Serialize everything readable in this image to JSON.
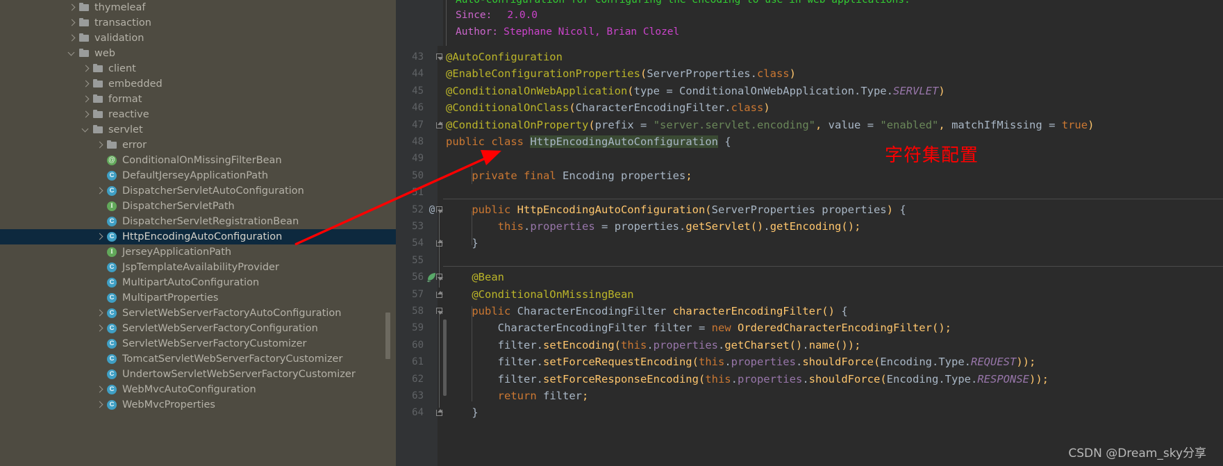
{
  "sidebar": {
    "items": [
      {
        "label": "thymeleaf",
        "icon": "folder-icon",
        "arrow": "right",
        "indent": 0
      },
      {
        "label": "transaction",
        "icon": "folder-icon",
        "arrow": "right",
        "indent": 0
      },
      {
        "label": "validation",
        "icon": "folder-icon",
        "arrow": "right",
        "indent": 0
      },
      {
        "label": "web",
        "icon": "folder-icon",
        "arrow": "down",
        "indent": 0
      },
      {
        "label": "client",
        "icon": "folder-icon",
        "arrow": "right",
        "indent": 1
      },
      {
        "label": "embedded",
        "icon": "folder-icon",
        "arrow": "right",
        "indent": 1
      },
      {
        "label": "format",
        "icon": "folder-icon",
        "arrow": "right",
        "indent": 1
      },
      {
        "label": "reactive",
        "icon": "folder-icon",
        "arrow": "right",
        "indent": 1
      },
      {
        "label": "servlet",
        "icon": "folder-icon",
        "arrow": "down",
        "indent": 1
      },
      {
        "label": "error",
        "icon": "folder-icon",
        "arrow": "right",
        "indent": 2
      },
      {
        "label": "ConditionalOnMissingFilterBean",
        "icon": "annotation-icon",
        "arrow": "none",
        "indent": 2
      },
      {
        "label": "DefaultJerseyApplicationPath",
        "icon": "class-icon",
        "arrow": "none",
        "indent": 2
      },
      {
        "label": "DispatcherServletAutoConfiguration",
        "icon": "class-icon",
        "arrow": "right",
        "indent": 2
      },
      {
        "label": "DispatcherServletPath",
        "icon": "interface-icon",
        "arrow": "none",
        "indent": 2
      },
      {
        "label": "DispatcherServletRegistrationBean",
        "icon": "class-icon",
        "arrow": "none",
        "indent": 2
      },
      {
        "label": "HttpEncodingAutoConfiguration",
        "icon": "class-icon",
        "arrow": "right",
        "indent": 2,
        "selected": true
      },
      {
        "label": "JerseyApplicationPath",
        "icon": "interface-icon",
        "arrow": "none",
        "indent": 2
      },
      {
        "label": "JspTemplateAvailabilityProvider",
        "icon": "class-icon",
        "arrow": "none",
        "indent": 2
      },
      {
        "label": "MultipartAutoConfiguration",
        "icon": "class-icon",
        "arrow": "none",
        "indent": 2
      },
      {
        "label": "MultipartProperties",
        "icon": "class-icon",
        "arrow": "none",
        "indent": 2
      },
      {
        "label": "ServletWebServerFactoryAutoConfiguration",
        "icon": "class-icon",
        "arrow": "right",
        "indent": 2
      },
      {
        "label": "ServletWebServerFactoryConfiguration",
        "icon": "class-icon",
        "arrow": "right",
        "indent": 2
      },
      {
        "label": "ServletWebServerFactoryCustomizer",
        "icon": "class-icon",
        "arrow": "none",
        "indent": 2
      },
      {
        "label": "TomcatServletWebServerFactoryCustomizer",
        "icon": "class-icon",
        "arrow": "none",
        "indent": 2
      },
      {
        "label": "UndertowServletWebServerFactoryCustomizer",
        "icon": "class-icon",
        "arrow": "none",
        "indent": 2
      },
      {
        "label": "WebMvcAutoConfiguration",
        "icon": "class-icon",
        "arrow": "right",
        "indent": 2
      },
      {
        "label": "WebMvcProperties",
        "icon": "class-icon",
        "arrow": "right",
        "indent": 2
      }
    ]
  },
  "doc_popup": {
    "description": "Auto-configuration for configuring the encoding to use in web applications.",
    "since_label": "Since:",
    "since_value": "2.0.0",
    "author_label": "Author:",
    "author_value": "Stephane Nicoll, Brian Clozel"
  },
  "editor": {
    "first_line_number": 43,
    "lines": [
      {
        "n": 43,
        "text": "@AutoConfiguration"
      },
      {
        "n": 44,
        "text": "@EnableConfigurationProperties(ServerProperties.class)"
      },
      {
        "n": 45,
        "text": "@ConditionalOnWebApplication(type = ConditionalOnWebApplication.Type.SERVLET)"
      },
      {
        "n": 46,
        "text": "@ConditionalOnClass(CharacterEncodingFilter.class)"
      },
      {
        "n": 47,
        "text": "@ConditionalOnProperty(prefix = \"server.servlet.encoding\", value = \"enabled\", matchIfMissing = true)"
      },
      {
        "n": 48,
        "text": "public class HttpEncodingAutoConfiguration {"
      },
      {
        "n": 49,
        "text": ""
      },
      {
        "n": 50,
        "text": "    private final Encoding properties;"
      },
      {
        "n": 51,
        "text": ""
      },
      {
        "n": 52,
        "text": "    public HttpEncodingAutoConfiguration(ServerProperties properties) {"
      },
      {
        "n": 53,
        "text": "        this.properties = properties.getServlet().getEncoding();"
      },
      {
        "n": 54,
        "text": "    }"
      },
      {
        "n": 55,
        "text": ""
      },
      {
        "n": 56,
        "text": "    @Bean"
      },
      {
        "n": 57,
        "text": "    @ConditionalOnMissingBean"
      },
      {
        "n": 58,
        "text": "    public CharacterEncodingFilter characterEncodingFilter() {"
      },
      {
        "n": 59,
        "text": "        CharacterEncodingFilter filter = new OrderedCharacterEncodingFilter();"
      },
      {
        "n": 60,
        "text": "        filter.setEncoding(this.properties.getCharset().name());"
      },
      {
        "n": 61,
        "text": "        filter.setForceRequestEncoding(this.properties.shouldForce(Encoding.Type.REQUEST));"
      },
      {
        "n": 62,
        "text": "        filter.setForceResponseEncoding(this.properties.shouldForce(Encoding.Type.RESPONSE));"
      },
      {
        "n": 63,
        "text": "        return filter;"
      },
      {
        "n": 64,
        "text": "    }"
      }
    ],
    "gutter_markers": [
      {
        "line": 52,
        "icon": "override-at-icon"
      },
      {
        "line": 56,
        "icon": "spring-bean-icon"
      }
    ],
    "highlighted_identifier": "HttpEncodingAutoConfiguration"
  },
  "annotation": {
    "note_text": "字符集配置",
    "note_color": "#ff0000",
    "arrow_color": "#ff0000"
  },
  "watermark": {
    "text": "CSDN @Dream_sky分享"
  },
  "colors": {
    "sidebar_bg": "#4e4b41",
    "selection_bg": "#0d293e",
    "editor_bg": "#2b2b2b",
    "gutter_bg": "#313335",
    "keyword": "#cc7832",
    "annotation": "#bbb529",
    "string": "#6a8759",
    "field": "#9876aa",
    "method": "#ffc66d",
    "identifier": "#a9b7c6",
    "comment": "#629755"
  }
}
